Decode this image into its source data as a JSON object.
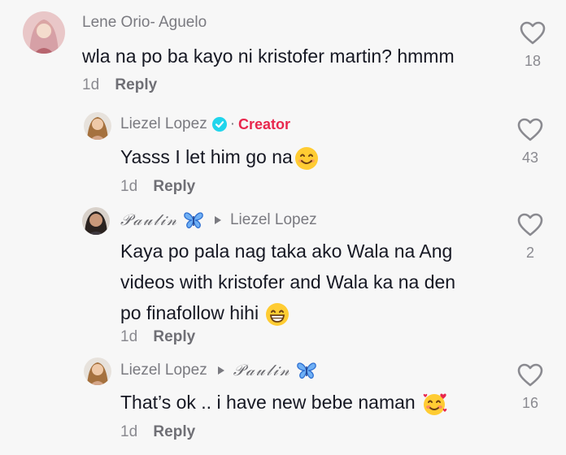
{
  "comments": [
    {
      "username": "Lene Orio- Aguelo",
      "text": "wla na po ba kayo ni kristofer martin? hmmm",
      "time": "1d",
      "reply": "Reply",
      "likes": "18"
    },
    {
      "username": "Liezel Lopez",
      "badge": "Creator",
      "text": "Yasss I let him go na",
      "time": "1d",
      "reply": "Reply",
      "likes": "43"
    },
    {
      "username": "𝒫𝒶𝓊𝓁𝒾𝓃",
      "reply_to": "Liezel Lopez",
      "text_lines": [
        "Kaya po pala nag taka ako Wala na Ang",
        "videos with kristofer and Wala ka na den",
        "po finafollow hihi"
      ],
      "time": "1d",
      "reply": "Reply",
      "likes": "2"
    },
    {
      "username": "Liezel Lopez",
      "reply_to": "𝒫𝒶𝓊𝓁𝒾𝓃",
      "text": "That’s ok .. i have new bebe naman",
      "time": "1d",
      "reply": "Reply",
      "likes": "16"
    }
  ],
  "colors": {
    "background": "#f7f7f7",
    "creator_badge": "#e8274d",
    "verified": "#20d5ec",
    "butterfly": "#3b7fe0"
  },
  "icons": [
    "heart-outline-icon",
    "verified-icon",
    "reply-arrow-icon",
    "butterfly-icon",
    "smiling-emoji",
    "grinning-emoji",
    "smiling-hearts-emoji"
  ]
}
